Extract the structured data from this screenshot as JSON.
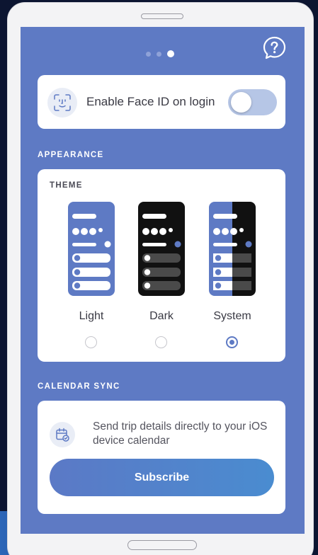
{
  "pager": {
    "total": 3,
    "active_index": 2
  },
  "help_button": {
    "icon": "question-bubble-icon"
  },
  "face_id": {
    "icon": "face-id-icon",
    "label": "Enable Face ID on login",
    "enabled": false
  },
  "appearance": {
    "section_label": "APPEARANCE",
    "theme_title": "THEME",
    "options": [
      {
        "label": "Light",
        "selected": false
      },
      {
        "label": "Dark",
        "selected": false
      },
      {
        "label": "System",
        "selected": true
      }
    ]
  },
  "calendar_sync": {
    "section_label": "CALENDAR SYNC",
    "icon": "calendar-icon",
    "description": "Send trip details directly to your iOS device calendar",
    "button_label": "Subscribe"
  },
  "colors": {
    "screen_bg": "#5e7ac4",
    "accent": "#5e7ac4",
    "toggle_off": "#b6c6e6",
    "page_bg": "#0c1531"
  }
}
